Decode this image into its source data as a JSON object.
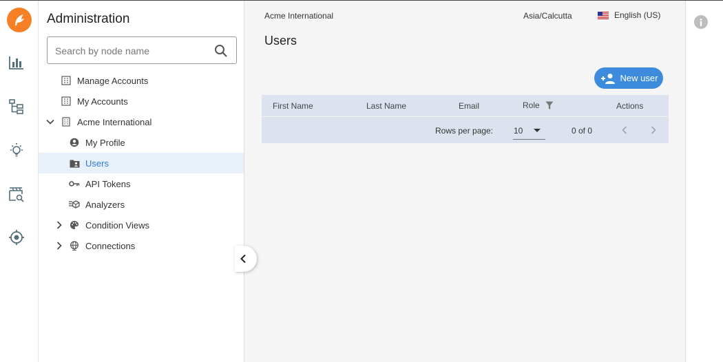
{
  "rail": {
    "icons": [
      "logo-icon",
      "bar-chart-icon",
      "hierarchy-icon",
      "lightbulb-icon",
      "media-search-icon",
      "target-icon"
    ]
  },
  "sidebar": {
    "title": "Administration",
    "search_placeholder": "Search by node name",
    "items": [
      {
        "label": "Manage Accounts",
        "icon": "building-icon"
      },
      {
        "label": "My Accounts",
        "icon": "building-icon"
      },
      {
        "label": "Acme International",
        "icon": "building-icon",
        "expanded": true
      },
      {
        "label": "My Profile",
        "icon": "profile-icon"
      },
      {
        "label": "Users",
        "icon": "users-folder-icon",
        "selected": true
      },
      {
        "label": "API Tokens",
        "icon": "key-icon"
      },
      {
        "label": "Analyzers",
        "icon": "analyzer-icon"
      },
      {
        "label": "Condition Views",
        "icon": "palette-icon",
        "expanded": false
      },
      {
        "label": "Connections",
        "icon": "globe-icon",
        "expanded": false
      }
    ]
  },
  "topbar": {
    "organization": "Acme International",
    "timezone": "Asia/Calcutta",
    "language": "English (US)"
  },
  "main": {
    "title": "Users",
    "new_user_label": "New user",
    "columns": [
      "First Name",
      "Last Name",
      "Email",
      "Role",
      "Actions"
    ],
    "rows": [],
    "pagination": {
      "rows_per_page_label": "Rows per page:",
      "rows_per_page": "10",
      "range": "0 of 0"
    }
  },
  "colors": {
    "accent": "#3d8bdc",
    "brand": "#f58025",
    "selected_bg": "#e8f0fa",
    "table_bg": "#dde3ee"
  }
}
